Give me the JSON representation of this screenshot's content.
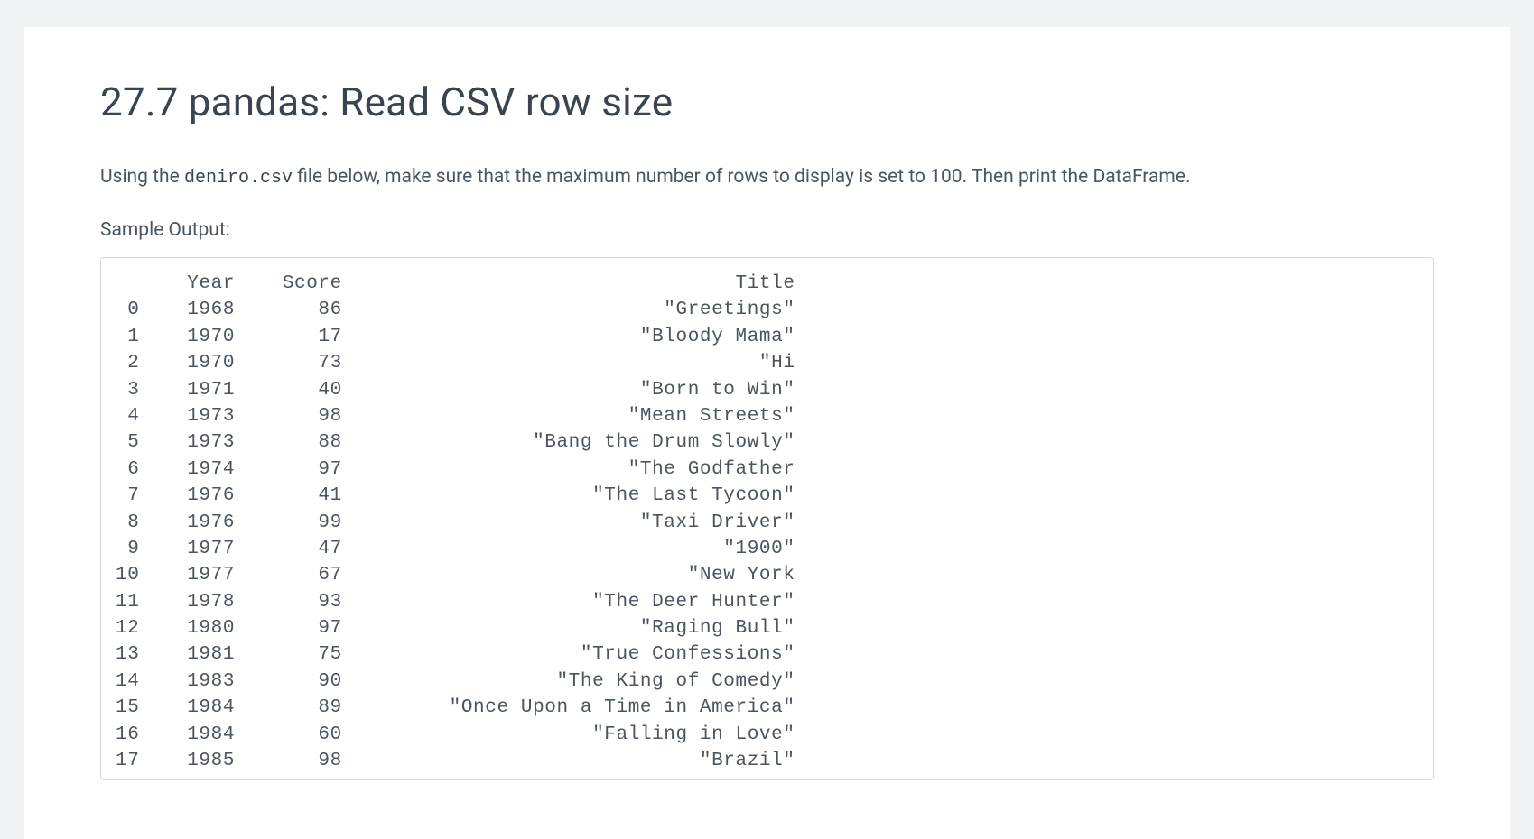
{
  "page": {
    "title": "27.7 pandas: Read CSV row size",
    "instruction_prefix": "Using the ",
    "instruction_code": "deniro.csv",
    "instruction_suffix": " file below, make sure that the maximum number of rows to display is set to 100. Then print the DataFrame.",
    "sample_output_label": "Sample Output:"
  },
  "output": {
    "idx_width": 2,
    "year_width": 6,
    "score_width": 7,
    "title_width": 36,
    "header": {
      "idx": "",
      "year": "Year",
      "score": "Score",
      "title": "Title"
    },
    "rows": [
      {
        "idx": "0",
        "year": "1968",
        "score": "86",
        "title": "\"Greetings\""
      },
      {
        "idx": "1",
        "year": "1970",
        "score": "17",
        "title": "\"Bloody Mama\""
      },
      {
        "idx": "2",
        "year": "1970",
        "score": "73",
        "title": "\"Hi"
      },
      {
        "idx": "3",
        "year": "1971",
        "score": "40",
        "title": "\"Born to Win\""
      },
      {
        "idx": "4",
        "year": "1973",
        "score": "98",
        "title": "\"Mean Streets\""
      },
      {
        "idx": "5",
        "year": "1973",
        "score": "88",
        "title": "\"Bang the Drum Slowly\""
      },
      {
        "idx": "6",
        "year": "1974",
        "score": "97",
        "title": "\"The Godfather"
      },
      {
        "idx": "7",
        "year": "1976",
        "score": "41",
        "title": "\"The Last Tycoon\""
      },
      {
        "idx": "8",
        "year": "1976",
        "score": "99",
        "title": "\"Taxi Driver\""
      },
      {
        "idx": "9",
        "year": "1977",
        "score": "47",
        "title": "\"1900\""
      },
      {
        "idx": "10",
        "year": "1977",
        "score": "67",
        "title": "\"New York"
      },
      {
        "idx": "11",
        "year": "1978",
        "score": "93",
        "title": "\"The Deer Hunter\""
      },
      {
        "idx": "12",
        "year": "1980",
        "score": "97",
        "title": "\"Raging Bull\""
      },
      {
        "idx": "13",
        "year": "1981",
        "score": "75",
        "title": "\"True Confessions\""
      },
      {
        "idx": "14",
        "year": "1983",
        "score": "90",
        "title": "\"The King of Comedy\""
      },
      {
        "idx": "15",
        "year": "1984",
        "score": "89",
        "title": "\"Once Upon a Time in America\""
      },
      {
        "idx": "16",
        "year": "1984",
        "score": "60",
        "title": "\"Falling in Love\""
      },
      {
        "idx": "17",
        "year": "1985",
        "score": "98",
        "title": "\"Brazil\""
      }
    ]
  }
}
